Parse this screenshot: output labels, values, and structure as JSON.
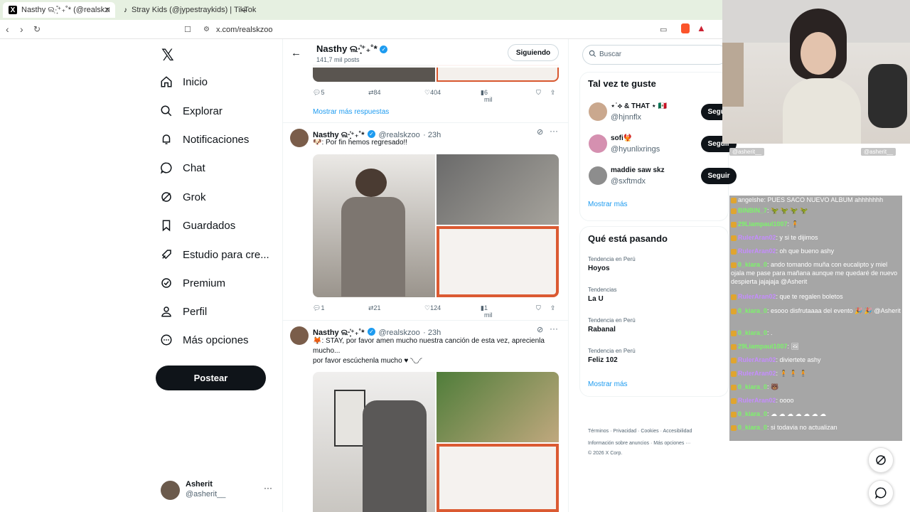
{
  "browser": {
    "tabs": [
      {
        "label": "Nasthy ଲ·͙̣̊⁺₊˚*  (@realskzoo) / X",
        "active": true
      },
      {
        "label": "Stray Kids (@jypestraykids) | TikTok",
        "active": false
      }
    ],
    "url": "x.com/realskzoo",
    "add_tab": "+"
  },
  "nav": {
    "items": [
      {
        "label": "Inicio",
        "icon": "home-icon"
      },
      {
        "label": "Explorar",
        "icon": "search-icon"
      },
      {
        "label": "Notificaciones",
        "icon": "bell-icon"
      },
      {
        "label": "Chat",
        "icon": "chat-icon"
      },
      {
        "label": "Grok",
        "icon": "grok-icon"
      },
      {
        "label": "Guardados",
        "icon": "bookmark-icon"
      },
      {
        "label": "Estudio para cre...",
        "icon": "rocket-icon"
      },
      {
        "label": "Premium",
        "icon": "premium-icon"
      },
      {
        "label": "Perfil",
        "icon": "person-icon"
      },
      {
        "label": "Más opciones",
        "icon": "more-icon"
      }
    ],
    "post_button": "Postear",
    "profile": {
      "name": "Asherit",
      "handle": "@asherit__",
      "more": "···"
    }
  },
  "header": {
    "name": "Nasthy ଲ·͙̣̊⁺₊˚*",
    "posts": "141,7 mil posts",
    "following_button": "Siguiendo"
  },
  "tweet0_actions": {
    "replies": "5",
    "retweets": "84",
    "likes": "404",
    "views": "6 mil"
  },
  "more_replies": "Mostrar más respuestas",
  "tweet1": {
    "name": "Nasthy ଲ·͙̣̊⁺₊˚*",
    "handle": "@realskzoo",
    "time": "· 23h",
    "text": "🐶: Por fin hemos regresado!!",
    "replies": "1",
    "retweets": "21",
    "likes": "124",
    "views": "1 mil"
  },
  "tweet2": {
    "name": "Nasthy ଲ·͙̣̊⁺₊˚*",
    "handle": "@realskzoo",
    "time": "· 23h",
    "text1": "🦊: STAY, por favor amen mucho nuestra canción de esta vez, aprecienla mucho...",
    "text2": "por favor escúchenla mucho ♥ ◝◡◜"
  },
  "right": {
    "search_placeholder": "Buscar",
    "suggest_title": "Tal vez te guste",
    "suggestions": [
      {
        "name": "⋆˙⟡ & THAT ⋆ 🇲🇽",
        "handle": "@hjnnflx",
        "button": "Seguir"
      },
      {
        "name": "sofi🐦‍🔥",
        "handle": "@hyunlixrings",
        "button": "Seguir"
      },
      {
        "name": "maddie saw skz",
        "handle": "@sxftmdx",
        "button": "Seguir"
      }
    ],
    "show_more": "Mostrar más",
    "trends_title": "Qué está pasando",
    "trends": [
      {
        "sub": "Tendencia en Perú",
        "name": "Hoyos"
      },
      {
        "sub": "Tendencias",
        "name": "La U"
      },
      {
        "sub": "Tendencia en Perú",
        "name": "Rabanal"
      },
      {
        "sub": "Tendencia en Perú",
        "name": "Feliz 102"
      }
    ],
    "show_more2": "Mostrar más",
    "footer1": [
      "Términos",
      "Privacidad",
      "Cookies",
      "Accesibilidad"
    ],
    "footer2": [
      "Información sobre anuncios",
      "Más opciones ···"
    ],
    "copyright": "© 2026 X Corp."
  },
  "chat": {
    "header_left": "@asherit__",
    "header_right": "@asherit__",
    "lines": [
      {
        "user": "",
        "text": "angelshe: PUES SACO NUEVO ALBUM ahhhhhhh",
        "color": "#ffffff"
      },
      {
        "user": "BINBIN_7",
        "text": ": 🦖 🦖 🦖 🦖",
        "color": "#7cf56a"
      },
      {
        "user": "29Liampaul1007",
        "text": ": 🧍",
        "color": "#7cf56a"
      },
      {
        "user": "RulerAran02",
        "text": ": y si te dijimos",
        "color": "#c58cff"
      },
      {
        "user": "RulerAran02",
        "text": ": oh que bueno ashy",
        "color": "#c58cff"
      },
      {
        "user": "0_kiara_0",
        "text": ": ando tomando muña con eucalipto y miel ojala me pase para mañana aunque me quedaré de nuevo despierta jajajaja @Asherit",
        "color": "#7cf56a"
      },
      {
        "user": "RulerAran02",
        "text": ": que te regalen boletos",
        "color": "#c58cff"
      },
      {
        "user": "0_kiara_0",
        "text": ": esooo disfrutaaaa del evento 🎉 🎉 @Asherit",
        "color": "#7cf56a"
      },
      {
        "user": "0_kiara_0",
        "text": ": .",
        "color": "#7cf56a"
      },
      {
        "user": "29Liampaul1007",
        "text": ": 🖼",
        "color": "#7cf56a"
      },
      {
        "user": "RulerAran02",
        "text": ": diviertete ashy",
        "color": "#c58cff"
      },
      {
        "user": "RulerAran02",
        "text": ": 🧍 🧍 🧍",
        "color": "#c58cff"
      },
      {
        "user": "0_kiara_0",
        "text": ": 🐻",
        "color": "#7cf56a"
      },
      {
        "user": "RulerAran02",
        "text": ": oooo",
        "color": "#c58cff"
      },
      {
        "user": "0_kiara_0",
        "text": ": ☁ ☁ ☁ ☁ ☁ ☁ ☁",
        "color": "#7cf56a"
      },
      {
        "user": "0_kiara_0",
        "text": ": si todavia no actualizan",
        "color": "#7cf56a"
      }
    ]
  }
}
